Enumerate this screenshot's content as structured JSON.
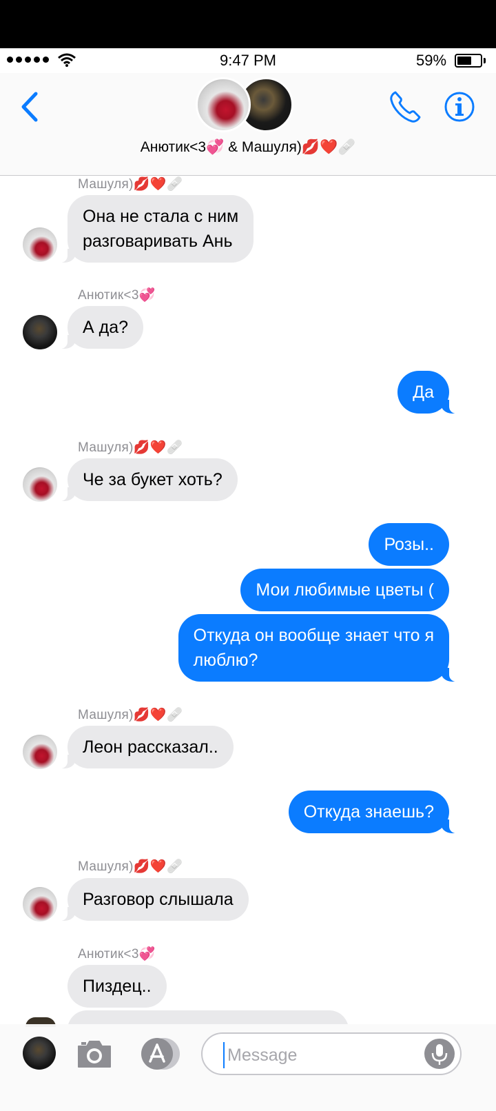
{
  "status_bar": {
    "time": "9:47 PM",
    "battery_percent": "59%",
    "battery_level": 0.59,
    "signal_bars": 5,
    "icons": [
      "signal-dots-icon",
      "wifi-icon",
      "battery-icon"
    ]
  },
  "header": {
    "title": "Анютик<3💞 & Машуля)💋❤️🩹",
    "icons": [
      "back-chevron-icon",
      "phone-icon",
      "info-icon"
    ],
    "accent_color": "#0b7cff"
  },
  "messages": [
    {
      "sender": "Машуля)💋❤️🩹",
      "text": "Она не стала с ним\nразговаривать Ань",
      "dir": "in"
    },
    {
      "sender": "Анютик<3💞",
      "text": "А да?",
      "dir": "in"
    },
    {
      "text": "Да",
      "dir": "out"
    },
    {
      "sender": "Машуля)💋❤️🩹",
      "text": "Че за букет хоть?",
      "dir": "in"
    },
    {
      "text": "Розы..",
      "dir": "out"
    },
    {
      "text": "Мои любимые цветы (",
      "dir": "out"
    },
    {
      "text": "Откуда он вообще знает что я\nлюблю?",
      "dir": "out"
    },
    {
      "sender": "Машуля)💋❤️🩹",
      "text": "Леон рассказал..",
      "dir": "in"
    },
    {
      "text": "Откуда знаешь?",
      "dir": "out"
    },
    {
      "sender": "Машуля)💋❤️🩹",
      "text": "Разговор слышала",
      "dir": "in"
    },
    {
      "sender": "Анютик<3💞",
      "text": "Пиздец..",
      "dir": "in"
    }
  ],
  "input_bar": {
    "placeholder": "Message",
    "icons": [
      "camera-icon",
      "app-store-icon",
      "microphone-icon"
    ]
  }
}
